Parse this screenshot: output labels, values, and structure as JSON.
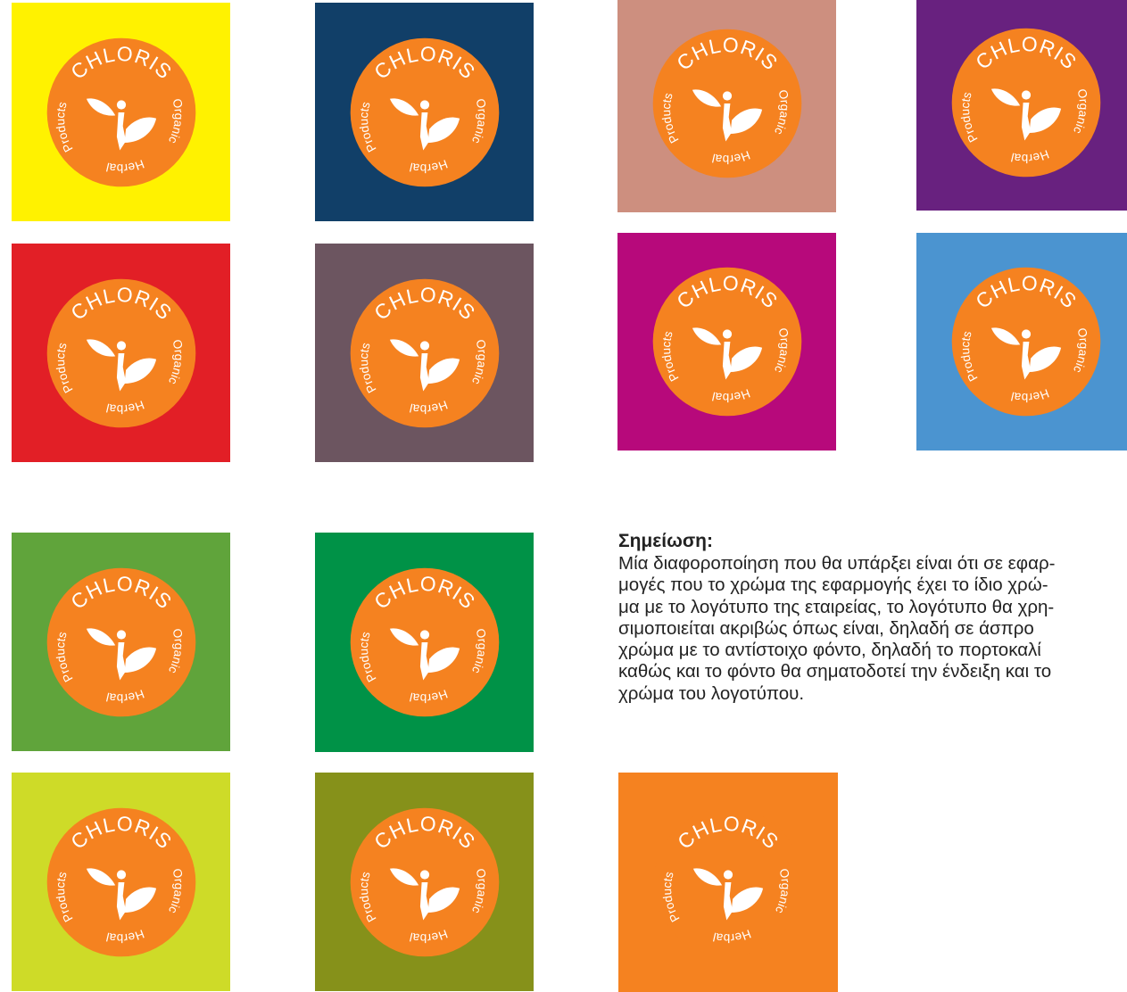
{
  "logo": {
    "brand_text": "CHLORIS",
    "organic_text": "Organic",
    "herbal_text": "Herbal",
    "products_text": "Products",
    "circle_color": "#f58220",
    "text_color": "#ffffff",
    "icon": "leaves-figure-icon"
  },
  "swatches": [
    {
      "name": "yellow",
      "color": "#fff200"
    },
    {
      "name": "navy",
      "color": "#113f68"
    },
    {
      "name": "dusty-rose",
      "color": "#cd8f7f"
    },
    {
      "name": "purple",
      "color": "#68217f"
    },
    {
      "name": "red",
      "color": "#e21f26"
    },
    {
      "name": "mauve-grey",
      "color": "#6c5560"
    },
    {
      "name": "magenta",
      "color": "#b7097b"
    },
    {
      "name": "sky-blue",
      "color": "#4b94d0"
    },
    {
      "name": "green",
      "color": "#60a43b"
    },
    {
      "name": "emerald",
      "color": "#009247"
    },
    {
      "name": "lime",
      "color": "#cedb28"
    },
    {
      "name": "olive",
      "color": "#86911a"
    },
    {
      "name": "orange",
      "color": "#f58220"
    }
  ],
  "note": {
    "title": "Σημείωση:",
    "lines": [
      "Μία διαφοροποίηση που θα υπάρξει είναι ότι σε εφαρ-",
      "μογές που το χρώμα της εφαρμογής έχει το ίδιο χρώ-",
      "μα με το λογότυπο της εταιρείας, το λογότυπο θα χρη-",
      "σιμοποιείται ακριβώς όπως είναι, δηλαδή σε άσπρο",
      "χρώμα με το αντίστοιχο φόντο, δηλαδή το πορτοκαλί",
      "καθώς και το φόντο θα σηματοδοτεί την ένδειξη και το",
      "χρώμα του λογοτύπου."
    ]
  }
}
